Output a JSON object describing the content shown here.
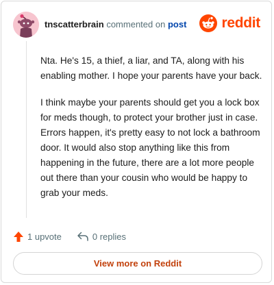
{
  "comment": {
    "username": "tnscatterbrain",
    "action_text": "commented on",
    "post_link_text": "post",
    "paragraphs": [
      "Nta. He's 15, a thief, a liar, and TA, along with his enabling mother. I hope your parents have your back.",
      "I think maybe your parents should get you a lock box for meds though, to protect your brother just in case. Errors happen, it's pretty easy to not lock a bathroom door. It would also stop anything like this from happening in the future, there are a lot more people out there than your cousin who would be happy to grab your meds."
    ],
    "upvote_label": "1 upvote",
    "replies_label": "0 replies",
    "view_more_label": "View more on Reddit"
  },
  "brand": {
    "name": "reddit",
    "color": "#ff4500"
  },
  "avatar": {
    "background": "#f7c5cf"
  },
  "icons": {
    "avatar": "snoo-avatar-icon",
    "brand": "reddit-logo-icon",
    "upvote": "upvote-arrow-icon",
    "replies": "reply-arrow-icon"
  },
  "colors": {
    "upvote_arrow": "#ff4500",
    "link": "#0045ac",
    "view_more_text": "#c2410c",
    "muted": "#576f76"
  }
}
